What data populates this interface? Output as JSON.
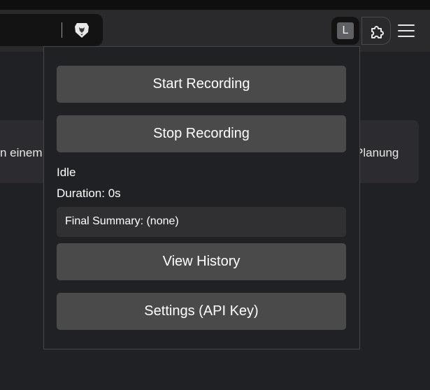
{
  "browser": {
    "extension_badge_letter": "L",
    "icons": {
      "brave": "brave-lion-icon",
      "extensions": "puzzle-piece-icon",
      "menu": "hamburger-menu-icon"
    },
    "colors": {
      "toolbar": "#2a2a2d",
      "address_bar": "#131314",
      "page_bg": "#202124"
    }
  },
  "background_content": {
    "left_card_text": "n einem ...",
    "right_card_text": "Planung"
  },
  "popup": {
    "start_button": "Start Recording",
    "stop_button": "Stop Recording",
    "status": "Idle",
    "duration": "Duration: 0s",
    "final_summary": "Final Summary: (none)",
    "history_button": "View History",
    "settings_button": "Settings (API Key)",
    "colors": {
      "button_bg": "#4a4a4a",
      "summary_bg": "#303033",
      "text": "#ffffff"
    }
  }
}
